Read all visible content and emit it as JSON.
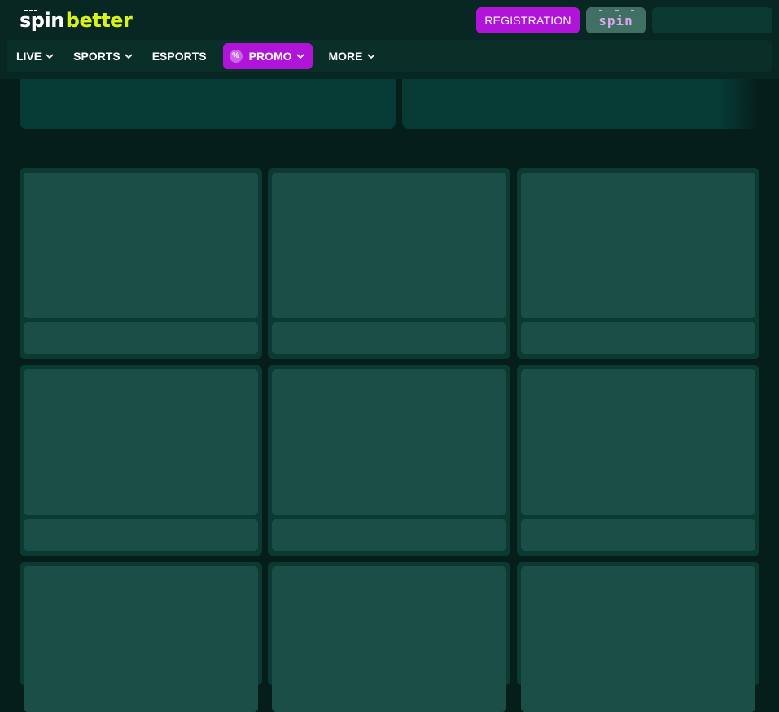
{
  "header": {
    "logo": {
      "part1": "spin",
      "part2": "better"
    },
    "registration_label": "REGISTRATION",
    "spin_badge": "spin"
  },
  "nav": {
    "items": [
      {
        "label": "LIVE",
        "has_dropdown": true
      },
      {
        "label": "SPORTS",
        "has_dropdown": true
      },
      {
        "label": "ESPORTS",
        "has_dropdown": false
      },
      {
        "label": "PROMO",
        "has_dropdown": true,
        "icon": "percent-icon"
      },
      {
        "label": "MORE",
        "has_dropdown": true
      }
    ]
  },
  "colors": {
    "background": "#061e1a",
    "header": "#082722",
    "accent_purple": "#b014d9",
    "logo_green": "#d9f21c",
    "card": "#0b3a32",
    "card_placeholder": "#1b4e47"
  },
  "cards": {
    "rows": 3,
    "columns": 3,
    "state": "loading-skeleton"
  }
}
